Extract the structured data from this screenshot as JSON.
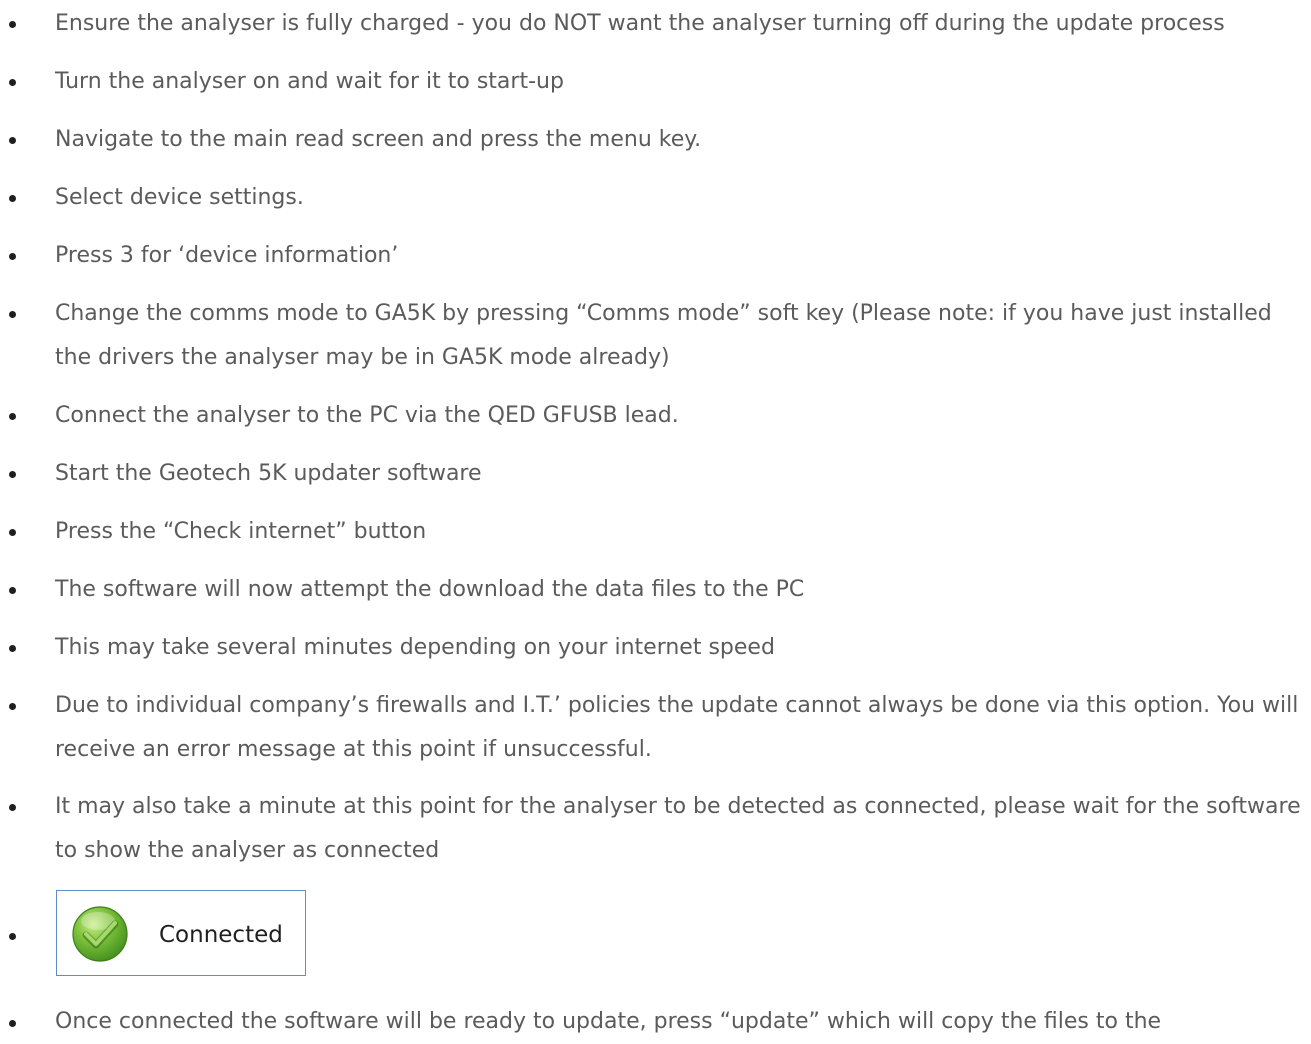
{
  "steps": [
    {
      "text": "Ensure the analyser is fully charged - you do NOT want the analyser turning off during the update process"
    },
    {
      "text": "Turn the analyser on and wait for it to start-up"
    },
    {
      "text": "Navigate to the main read screen and press the menu key."
    },
    {
      "text": "Select device settings."
    },
    {
      "text": "Press 3 for ‘device information’"
    },
    {
      "text": "Change the comms mode to GA5K by pressing “Comms mode” soft key (Please note: if you have just installed the drivers the analyser may be in GA5K mode already)"
    },
    {
      "text": "Connect the analyser to the PC via the QED GFUSB lead."
    },
    {
      "text": "Start the Geotech 5K updater software"
    },
    {
      "text": "Press the “Check internet” button"
    },
    {
      "text": "The software will now attempt the download the data files to the PC"
    },
    {
      "text": "This may take several minutes depending on your internet speed"
    },
    {
      "text": "Due to individual company’s firewalls and I.T.’ policies the update cannot always be done via this option. You will receive an error message at this point if unsuccessful."
    },
    {
      "text": "It may also take a minute at this point for the analyser to be detected as connected, please wait for the software to show the analyser as connected"
    },
    {
      "text": ""
    },
    {
      "text": "Once connected the software will be ready to update, press “update” which will copy the files to the"
    }
  ],
  "status": {
    "label": "Connected",
    "icon": "green-check-icon",
    "border_color": "#5b8ec6",
    "icon_color": "#5fa52e"
  }
}
